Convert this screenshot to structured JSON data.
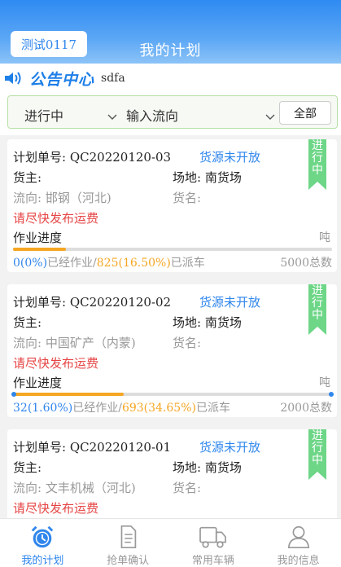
{
  "header": {
    "tenant_label": "测试0117",
    "title": "我的计划"
  },
  "notice": {
    "title": "公告中心",
    "text": "sdfa"
  },
  "filter": {
    "status": "进行中",
    "flow_placeholder": "输入流向",
    "all_label": "全部"
  },
  "status_tag": "进行中",
  "labels": {
    "plan_no": "计划单号: ",
    "owner": "货主:",
    "site": "场地: ",
    "flow": "流向: ",
    "goods": "货名:",
    "urge": "请尽快发布运费",
    "progress": "作业进度",
    "unit": "吨",
    "worked_suffix": "已经作业/",
    "dispatched_suffix": "已派车",
    "total_suffix": "总数"
  },
  "plans": [
    {
      "plan_no": "QC20220120-03",
      "source_status": "货源未开放",
      "site": "南货场",
      "flow": "邯钢（河北)",
      "worked": "0(0%)",
      "dispatched": "825(16.50%)",
      "total": "5000",
      "worked_fraction": 0.0,
      "dispatched_fraction": 0.165
    },
    {
      "plan_no": "QC20220120-02",
      "source_status": "货源未开放",
      "site": "南货场",
      "flow": "中国矿产（内蒙)",
      "worked": "32(1.60%)",
      "dispatched": "693(34.65%)",
      "total": "2000",
      "worked_fraction": 0.016,
      "dispatched_fraction": 0.3465
    },
    {
      "plan_no": "QC20220120-01",
      "source_status": "货源未开放",
      "site": "南货场",
      "flow": "文丰机械（河北)"
    }
  ],
  "tabs": [
    {
      "label": "我的计划",
      "icon": "alarm-clock-icon",
      "active": true
    },
    {
      "label": "抢单确认",
      "icon": "document-icon",
      "active": false
    },
    {
      "label": "常用车辆",
      "icon": "truck-icon",
      "active": false
    },
    {
      "label": "我的信息",
      "icon": "user-icon",
      "active": false
    }
  ],
  "colors": {
    "primary": "#2f86ec",
    "accent": "#f5a623",
    "warning": "#e64545",
    "tag": "#6dd687"
  }
}
